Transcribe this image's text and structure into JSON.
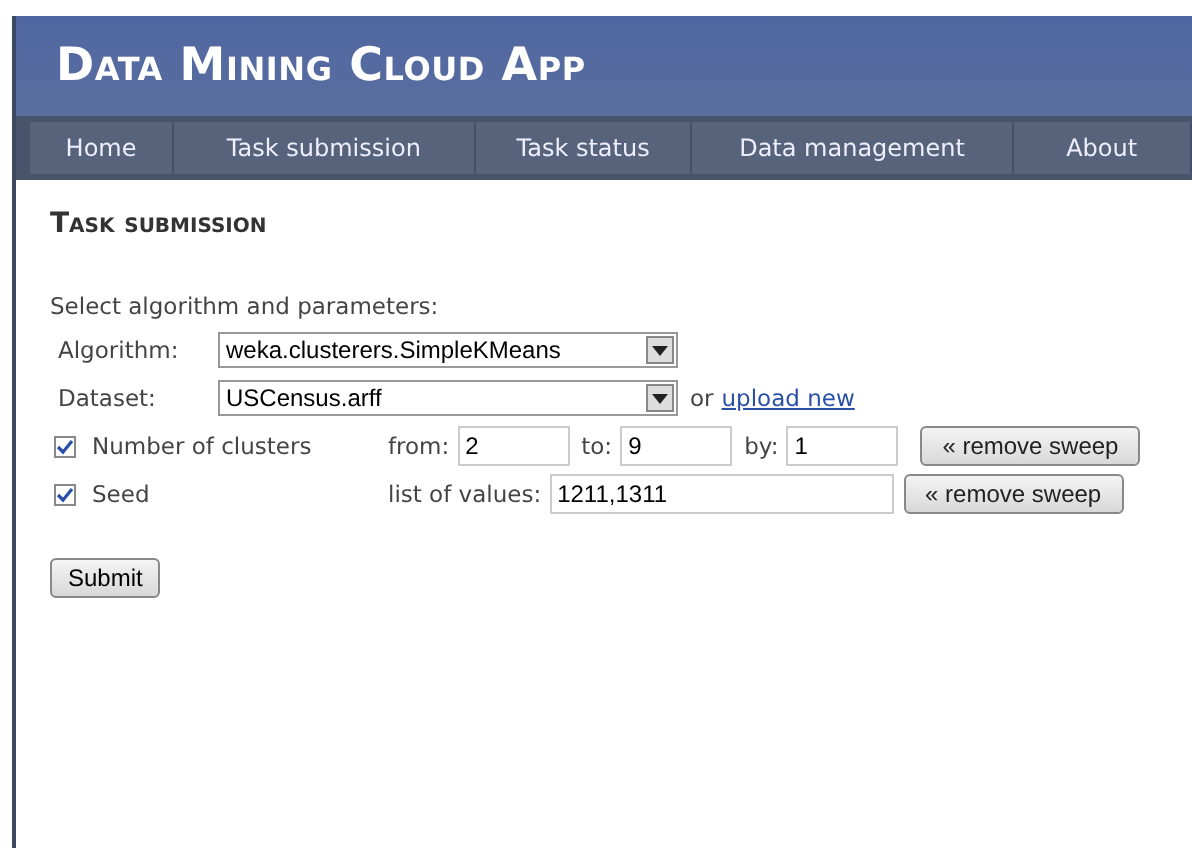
{
  "app_title": "Data Mining Cloud App",
  "nav": [
    {
      "label": "Home"
    },
    {
      "label": "Task submission"
    },
    {
      "label": "Task status"
    },
    {
      "label": "Data management"
    },
    {
      "label": "About"
    }
  ],
  "page_title": "Task submission",
  "intro": "Select algorithm and parameters:",
  "algorithm": {
    "label": "Algorithm:",
    "value": "weka.clusterers.SimpleKMeans"
  },
  "dataset": {
    "label": "Dataset:",
    "value": "USCensus.arff",
    "or_text": "or",
    "link": "upload new"
  },
  "params": [
    {
      "kind": "range",
      "label": "Number of clusters",
      "checked": true,
      "from_label": "from:",
      "from": "2",
      "to_label": "to:",
      "to": "9",
      "by_label": "by:",
      "by": "1",
      "button": "« remove sweep"
    },
    {
      "kind": "list",
      "label": "Seed",
      "checked": true,
      "list_label": "list of values:",
      "values": "1211,1311",
      "button": "« remove sweep"
    }
  ],
  "submit": "Submit"
}
